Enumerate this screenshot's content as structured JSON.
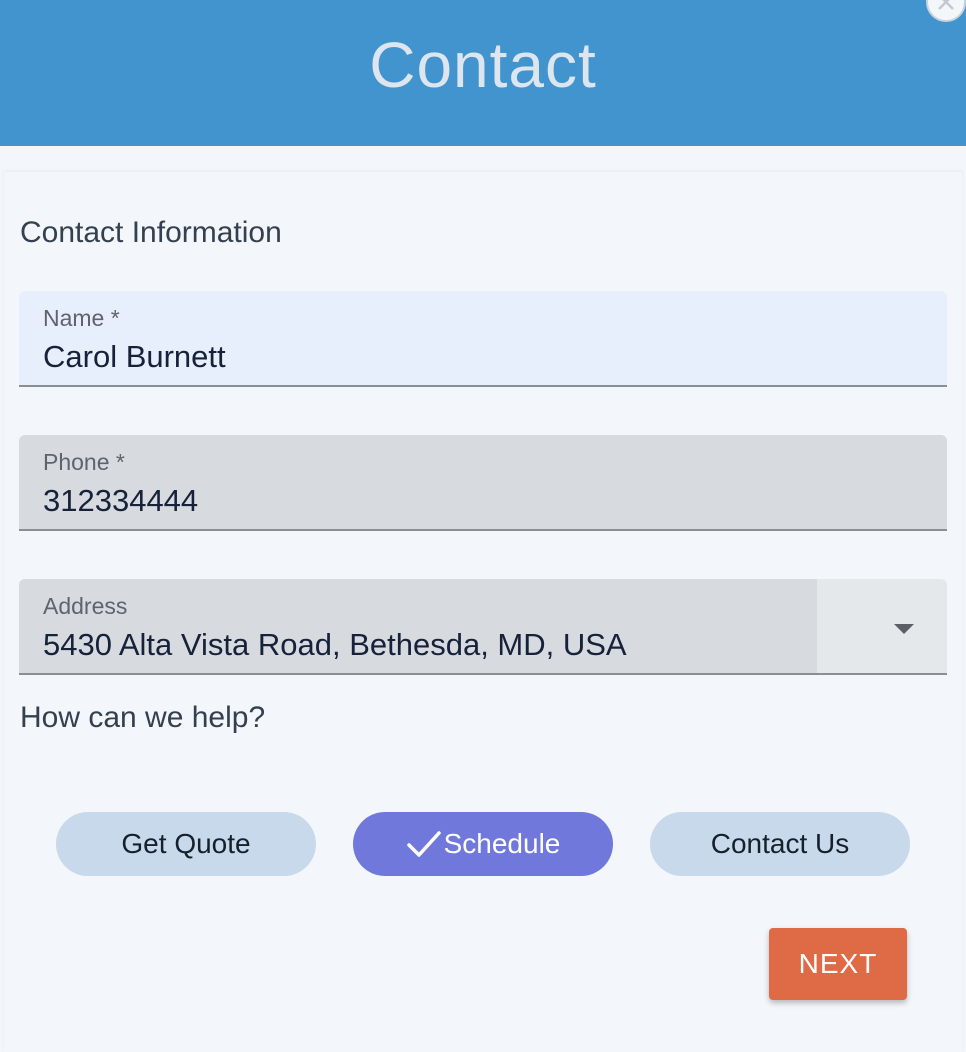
{
  "header": {
    "title": "Contact",
    "background": "#4294cf"
  },
  "form": {
    "section_title": "Contact Information",
    "fields": [
      {
        "label": "Name *",
        "value": "Carol Burnett"
      },
      {
        "label": "Phone *",
        "value": "312334444"
      },
      {
        "label": "Address",
        "value": "5430 Alta Vista Road, Bethesda, MD, USA"
      }
    ],
    "help_label": "How can we help?",
    "options": [
      {
        "label": "Get Quote",
        "selected": false
      },
      {
        "label": "Schedule",
        "selected": true,
        "icon": "check-icon"
      },
      {
        "label": "Contact Us",
        "selected": false
      }
    ],
    "next_label": "NEXT"
  },
  "colors": {
    "accent": "#4294cf",
    "selected_option": "#7078db",
    "option": "#c7d9ea",
    "next_button": "#de6b45"
  }
}
